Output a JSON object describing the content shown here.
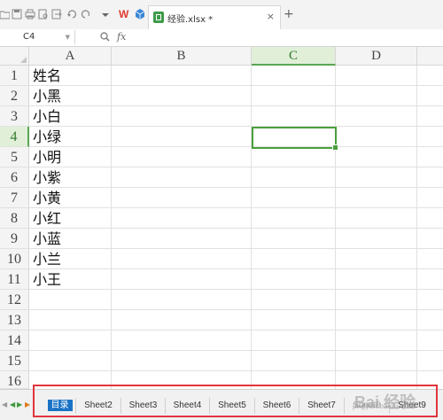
{
  "toolbar": {
    "icons": [
      "folder-icon",
      "save-icon",
      "print-icon",
      "print-preview-icon",
      "export-icon",
      "undo-icon",
      "redo-icon",
      "dropdown-icon",
      "wps-logo",
      "cube-icon"
    ],
    "wps_text": "W"
  },
  "doc_tab": {
    "title": "经验.xlsx *",
    "close": "×",
    "new_tab": "+"
  },
  "formula_bar": {
    "cell_ref": "C4",
    "fx": "fx",
    "value": ""
  },
  "columns": [
    "A",
    "B",
    "C",
    "D"
  ],
  "selected_column": "C",
  "rows": [
    "1",
    "2",
    "3",
    "4",
    "5",
    "6",
    "7",
    "8",
    "9",
    "10",
    "11",
    "12",
    "13",
    "14",
    "15",
    "16"
  ],
  "selected_row": "4",
  "cells_A": [
    "姓名",
    "小黑",
    "小白",
    "小绿",
    "小明",
    "小紫",
    "小黄",
    "小红",
    "小蓝",
    "小兰",
    "小王"
  ],
  "sheets": [
    "目录",
    "Sheet2",
    "Sheet3",
    "Sheet4",
    "Sheet5",
    "Sheet6",
    "Sheet7",
    "Sheet8",
    "Sheet9"
  ],
  "active_sheet": "目录",
  "colors": {
    "accent_green": "#4c9e3f",
    "active_tab": "#1a73c6",
    "annotation_red": "#e0353d"
  },
  "watermark": "Bai 经验",
  "watermark_sub": "jingyan.baidu.com"
}
